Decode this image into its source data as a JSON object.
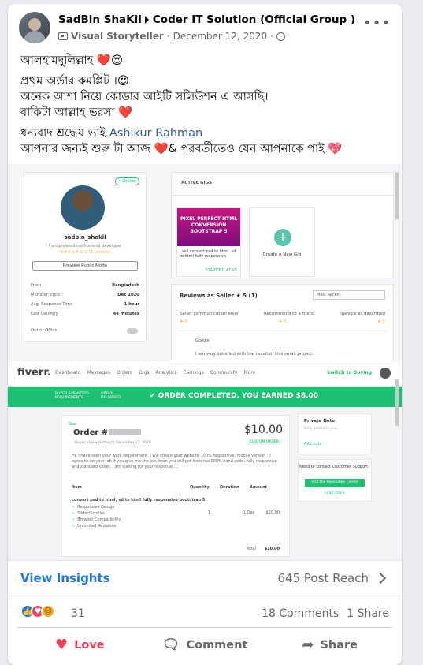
{
  "post": {
    "author": "SadBin ShaKil",
    "group": "Coder IT Solution (Official Group )",
    "role": "Visual Storyteller",
    "date": "December 12, 2020",
    "more_label": "•••",
    "lines": [
      "আলহামদুলিল্লাহ ❤️😍",
      "প্রথম অর্ডার কমপ্লিট ।😍",
      "অনেক আশা নিয়ে কোডার আইটি সলিউশন এ আসছি।",
      "বাকিটা আল্লাহ ভরসা ❤️"
    ],
    "thanks_prefix": "ধন্যবাদ শ্রদ্ধেয় ভাই",
    "thanks_name": "Ashikur Rahman",
    "last_line": "আপনার জন্যই শুরু টা আজ ❤️& পরবর্তীতেও যেন আপনাকে পাই 💖"
  },
  "screenshot": {
    "profile": {
      "online": "• Online",
      "username": "sadbin_shakil",
      "tagline": "I am professional frontend developer",
      "rating": "★★★★★ 5.0 (1 review)",
      "preview_button": "Preview Public Mode",
      "rows": [
        {
          "label": "From",
          "value": "Bangladesh"
        },
        {
          "label": "Member since",
          "value": "Dec 2020"
        },
        {
          "label": "Avg. Response Time",
          "value": "1 hour"
        },
        {
          "label": "Last Delivery",
          "value": "44 minutes"
        },
        {
          "label": "Out of Office",
          "value": ""
        }
      ]
    },
    "gigs": {
      "tab": "ACTIVE GIGS",
      "gig_image_text": "PIXEL PERFECT HTML CONVERSION BOOTSTRAP 5",
      "gig_title": "I will convert psd to html, xd to html fully responsive",
      "gig_price": "STARTING AT $5",
      "new_gig": "Create A New Gig"
    },
    "reviews": {
      "title": "Reviews as Seller ★ 5 (1)",
      "sort": "Most Recent",
      "cols": [
        "Seller communication level",
        "Recommend to a friend",
        "Service as described"
      ],
      "stars": [
        "★ 5",
        "★ 5",
        "★ 5"
      ],
      "reviewer_country": "Google",
      "review_text": "I am very satisfied with the result of this small project."
    },
    "fiverr": {
      "logo": "fiverr.",
      "nav": [
        "Dashboard",
        "Messages",
        "Orders",
        "Gigs",
        "Analytics",
        "Earnings",
        "Community",
        "More"
      ],
      "switch": "Switch to Buying",
      "mini1": "BUYER SUBMITTED REQUIREMENTS",
      "mini2": "ORDER DELIVERED",
      "completed": "✔ ORDER COMPLETED. YOU EARNED $8.00"
    },
    "order": {
      "star": "Star",
      "title": "Order #",
      "amount": "$10.00",
      "meta": "Buyer: (View History) | December 12, 2020",
      "custom": "CUSTOM ORDER",
      "message": "Hi, I have seen your work requirement. I will create your website 100% responsive, mobile version . I agree to do your job if you give me the job. then you will get from me 100% hand code, fully responsive and standard code.. I am waiting for your response.....",
      "headers": [
        "Item",
        "Quantity",
        "Duration",
        "Amount"
      ],
      "item": "convert psd to html, xd to html fully responsive bootstrap 5",
      "features": [
        "Responsive Design",
        "Slider/Scroller",
        "Browser Compatibility",
        "Unlimited Revisions"
      ],
      "qty": "1",
      "duration": "1 Day",
      "price": "$10.00",
      "total_label": "Total",
      "total": "$10.00"
    },
    "note": {
      "title": "Private Note",
      "placeholder": "Only visible to you",
      "add": "Add note"
    },
    "help": {
      "question": "Need to contact Customer Support?",
      "button": "Visit the Resolution Center",
      "learn": "Learn more"
    }
  },
  "insights": {
    "view_label": "View Insights",
    "reach": "645 Post Reach"
  },
  "reactions": {
    "count": "31",
    "comments": "18 Comments",
    "shares": "1 Share"
  },
  "actions": {
    "love": "Love",
    "comment": "Comment",
    "share": "Share"
  }
}
